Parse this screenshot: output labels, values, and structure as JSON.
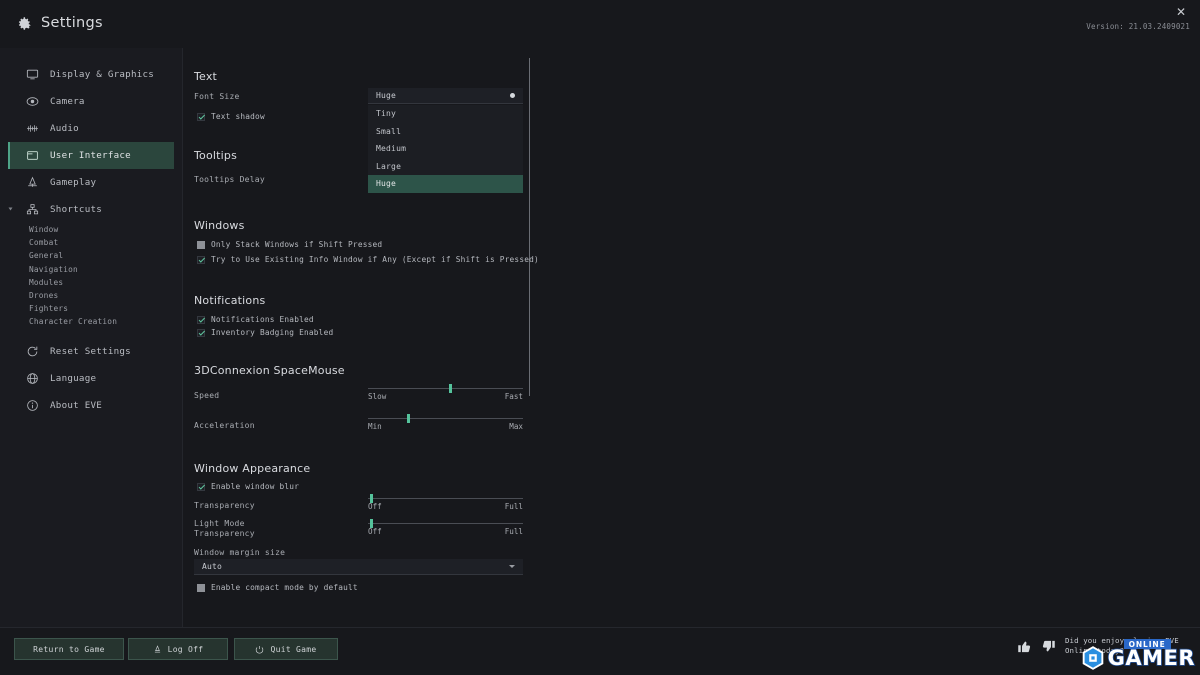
{
  "window": {
    "title": "Settings",
    "gear_icon": "gear-icon",
    "close_label": "✕",
    "version": "Version: 21.03.2409021"
  },
  "sidebar": {
    "items": [
      {
        "label": "Display & Graphics",
        "icon": "monitor-icon",
        "selected": false
      },
      {
        "label": "Camera",
        "icon": "camera-icon",
        "selected": false
      },
      {
        "label": "Audio",
        "icon": "waveform-icon",
        "selected": false
      },
      {
        "label": "User Interface",
        "icon": "window-icon",
        "selected": true
      },
      {
        "label": "Gameplay",
        "icon": "ship-icon",
        "selected": false
      },
      {
        "label": "Shortcuts",
        "icon": "shortcuts-icon",
        "selected": false,
        "expanded": true
      }
    ],
    "shortcuts_children": [
      "Window",
      "Combat",
      "General",
      "Navigation",
      "Modules",
      "Drones",
      "Fighters",
      "Character Creation"
    ],
    "footer_items": [
      {
        "label": "Reset Settings",
        "icon": "reset-icon"
      },
      {
        "label": "Language",
        "icon": "globe-icon"
      },
      {
        "label": "About EVE",
        "icon": "info-icon"
      }
    ]
  },
  "content": {
    "text_section": {
      "title": "Text",
      "font_size_label": "Font Size",
      "font_size_value": "Huge",
      "font_size_options": [
        "Tiny",
        "Small",
        "Medium",
        "Large",
        "Huge"
      ],
      "font_size_selected_option": "Huge",
      "text_shadow": {
        "label": "Text shadow",
        "checked": true
      }
    },
    "tooltips_section": {
      "title": "Tooltips",
      "delay_label": "Tooltips Delay"
    },
    "windows_section": {
      "title": "Windows",
      "options": [
        {
          "label": "Only Stack Windows if Shift Pressed",
          "checked": false
        },
        {
          "label": "Try to Use Existing Info Window if Any (Except if Shift is Pressed)",
          "checked": true
        }
      ]
    },
    "notifications_section": {
      "title": "Notifications",
      "options": [
        {
          "label": "Notifications Enabled",
          "checked": true
        },
        {
          "label": "Inventory Badging Enabled",
          "checked": true
        }
      ]
    },
    "spacemouse_section": {
      "title": "3DConnexion SpaceMouse",
      "sliders": [
        {
          "label": "Speed",
          "min_label": "Slow",
          "max_label": "Fast",
          "value_pct": 52
        },
        {
          "label": "Acceleration",
          "min_label": "Min",
          "max_label": "Max",
          "value_pct": 25
        }
      ]
    },
    "window_appearance_section": {
      "title": "Window Appearance",
      "enable_blur": {
        "label": "Enable window blur",
        "checked": true
      },
      "sliders": [
        {
          "label": "Transparency",
          "min_label": "Off",
          "max_label": "Full",
          "value_pct": 1
        },
        {
          "label": "Light Mode\nTransparency",
          "label_line1": "Light Mode",
          "label_line2": "Transparency",
          "min_label": "Off",
          "max_label": "Full",
          "value_pct": 1
        }
      ],
      "margin_label": "Window margin size",
      "margin_value": "Auto",
      "compact_mode": {
        "label": "Enable compact mode by default",
        "checked": false
      }
    }
  },
  "footer": {
    "buttons": [
      {
        "label": "Return to Game",
        "icon": null
      },
      {
        "label": "Log Off",
        "icon": "logoff-icon"
      },
      {
        "label": "Quit Game",
        "icon": "power-icon"
      }
    ],
    "feedback": {
      "thumbs_up_icon": "thumbs-up-icon",
      "thumbs_down_icon": "thumbs-down-icon",
      "line1": "Did you enjoy playing EVE Online",
      "line2": "today?"
    },
    "watermark": {
      "badge": "hexagon-badge-icon",
      "online": "ONLINE",
      "gamer": "GAMER"
    }
  },
  "colors": {
    "bg": "#17181c",
    "sidebar_bg": "#1a1b20",
    "accent_green": "#4ea387",
    "selected_nav_bg": "#2b463d",
    "dropdown_hl": "#2d5449",
    "button_bg": "#26342f",
    "slider_knob": "#55c39c",
    "watermark_blue": "#2a68c8"
  }
}
